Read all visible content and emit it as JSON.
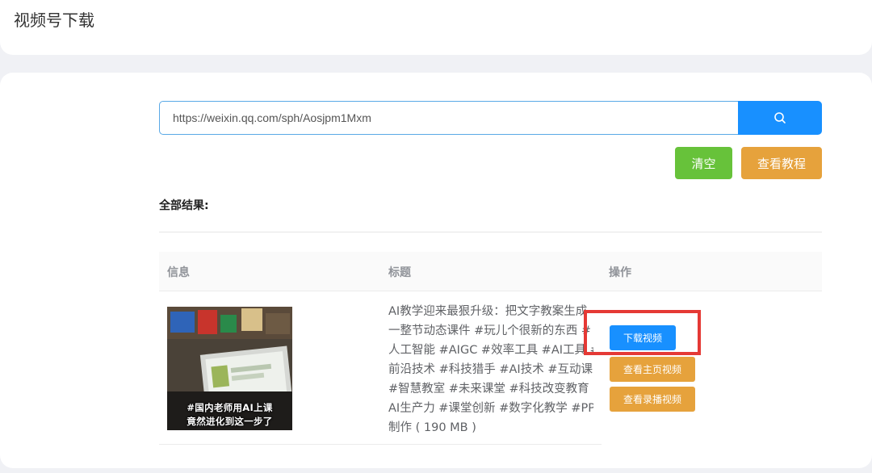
{
  "page": {
    "title": "视频号下载"
  },
  "search": {
    "value": "https://weixin.qq.com/sph/Aosjpm1Mxm",
    "icon": "search-icon"
  },
  "buttons": {
    "clear": "清空",
    "tutorial": "查看教程"
  },
  "results": {
    "label": "全部结果:",
    "columns": {
      "info": "信息",
      "title": "标题",
      "action": "操作"
    },
    "rows": [
      {
        "thumbnail_caption": [
          "#国内老师用AI上课",
          "竟然进化到这一步了"
        ],
        "title_lines": [
          "AI教学迎来最狠升级：把文字教案生成",
          "一整节动态课件 #玩儿个很新的东西 #",
          "人工智能 #AIGC #效率工具 #AI工具 #",
          "前沿技术 #科技猎手 #AI技术 #互动课堂",
          "#智慧教室 #未来课堂 #科技改变教育 #",
          "AI生产力 #课堂创新 #数字化教学 #PPT",
          "制作 ( 190 MB )"
        ],
        "actions": {
          "download": "下载视频",
          "home": "查看主页视频",
          "live": "查看录播视频"
        }
      }
    ]
  },
  "colors": {
    "primary": "#1890ff",
    "success": "#67c23a",
    "warning": "#e6a23c",
    "highlight": "#e53935"
  }
}
